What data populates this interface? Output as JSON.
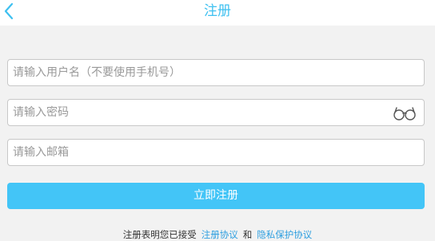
{
  "header": {
    "title": "注册",
    "back_icon": "chevron-left-icon",
    "accent_color": "#3ec0f0"
  },
  "form": {
    "username_placeholder": "请输入用户名（不要使用手机号）",
    "password_placeholder": "请输入密码",
    "password_toggle_icon": "glasses-icon",
    "email_placeholder": "请输入邮箱",
    "submit_label": "立即注册",
    "submit_color": "#43c5f7"
  },
  "terms": {
    "prefix": "注册表明您已接受",
    "terms_link": "注册协议",
    "conjunction": "和",
    "privacy_link": "隐私保护协议"
  }
}
